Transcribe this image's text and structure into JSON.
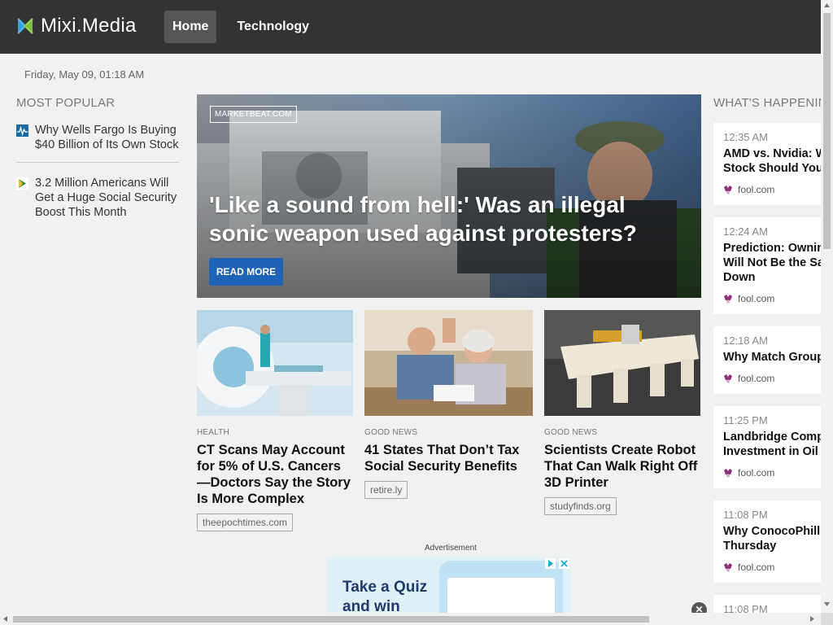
{
  "header": {
    "brand": "Mixi.Media",
    "nav": [
      {
        "label": "Home",
        "active": true
      },
      {
        "label": "Technology",
        "active": false
      }
    ]
  },
  "date": "Friday, May 09, 01:18 AM",
  "sidebar": {
    "title": "MOST POPULAR",
    "items": [
      {
        "icon": "stock-chart-icon",
        "text": "Why Wells Fargo Is Buying $40 Billion of Its Own Stock"
      },
      {
        "icon": "publisher-logo-icon",
        "text": "3.2 Million Americans Will Get a Huge Social Security Boost This Month"
      }
    ]
  },
  "hero": {
    "source": "MARKETBEAT.COM",
    "title": "'Like a sound from hell:' Was an illegal sonic weapon used against protesters?",
    "button": "READ MORE"
  },
  "cards": [
    {
      "category": "HEALTH",
      "title": "CT Scans May Account for 5% of U.S. Cancers—Doctors Say the Story Is More Complex",
      "source": "theepochtimes.com",
      "image": "ct-scanner-photo"
    },
    {
      "category": "GOOD NEWS",
      "title": "41 States That Don’t Tax Social Security Benefits",
      "source": "retire.ly",
      "image": "senior-couple-high-five-photo"
    },
    {
      "category": "GOOD NEWS",
      "title": "Scientists Create Robot That Can Walk Right Off 3D Printer",
      "source": "studyfinds.org",
      "image": "3d-printed-robot-photo"
    }
  ],
  "ad": {
    "label": "Advertisement",
    "text_line1": "Take a Quiz",
    "text_line2": "and win"
  },
  "right": {
    "title": "WHAT'S HAPPENIN",
    "items": [
      {
        "time": "12:35 AM",
        "title": "AMD vs. Nvidia: W\nStock Should You",
        "source": "fool.com"
      },
      {
        "time": "12:24 AM",
        "title": "Prediction: Ownin\nWill Not Be the Sa\nDown",
        "source": "fool.com"
      },
      {
        "time": "12:18 AM",
        "title": "Why Match Group",
        "source": "fool.com"
      },
      {
        "time": "11:25 PM",
        "title": "Landbridge Compa\nInvestment in Oil L",
        "source": "fool.com"
      },
      {
        "time": "11:08 PM",
        "title": "Why ConocoPhilli\nThursday",
        "source": "fool.com"
      },
      {
        "time": "11:08 PM",
        "title": "",
        "source": ""
      }
    ]
  },
  "colors": {
    "header_bg": "#333333",
    "accent_button": "#1f63b6",
    "page_bg": "#f1f1f1"
  }
}
